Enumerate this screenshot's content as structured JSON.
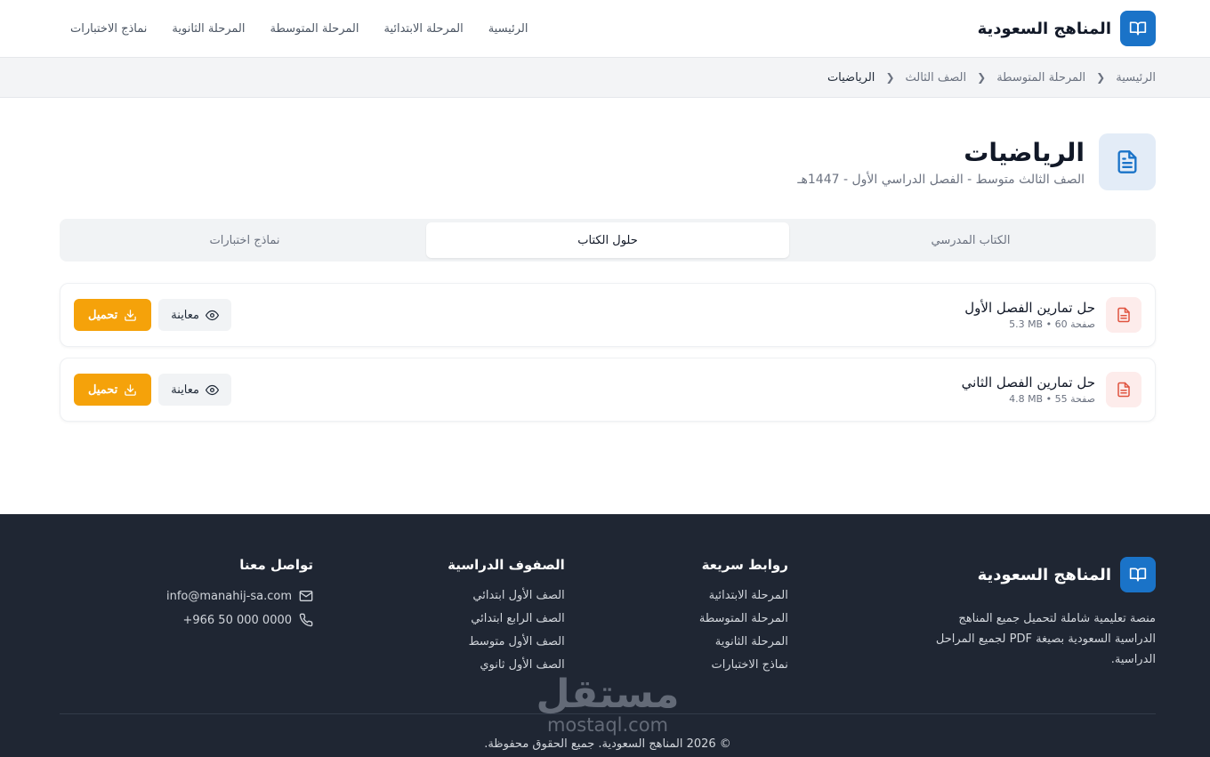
{
  "header": {
    "brand": "المناهج السعودية",
    "nav": [
      "الرئيسية",
      "المرحلة الابتدائية",
      "المرحلة المتوسطة",
      "المرحلة الثانوية",
      "نماذج الاختبارات"
    ]
  },
  "breadcrumb": [
    "الرئيسية",
    "المرحلة المتوسطة",
    "الصف الثالث",
    "الرياضيات"
  ],
  "page": {
    "title": "الرياضيات",
    "subtitle": "الصف الثالث متوسط - الفصل الدراسي الأول - 1447هـ"
  },
  "tabs": [
    {
      "label": "الكتاب المدرسي",
      "active": false
    },
    {
      "label": "حلول الكتاب",
      "active": true
    },
    {
      "label": "نماذج اختبارات",
      "active": false
    }
  ],
  "files": [
    {
      "name": "حل تمارين الفصل الأول",
      "meta": "5.3 MB • 60 صفحة",
      "preview_label": "معاينة",
      "download_label": "تحميل"
    },
    {
      "name": "حل تمارين الفصل الثاني",
      "meta": "4.8 MB • 55 صفحة",
      "preview_label": "معاينة",
      "download_label": "تحميل"
    }
  ],
  "footer": {
    "brand": "المناهج السعودية",
    "description": "منصة تعليمية شاملة لتحميل جميع المناهج الدراسية السعودية بصيغة PDF لجميع المراحل الدراسية.",
    "quick_links": {
      "title": "روابط سريعة",
      "items": [
        "المرحلة الابتدائية",
        "المرحلة المتوسطة",
        "المرحلة الثانوية",
        "نماذج الاختبارات"
      ]
    },
    "grades": {
      "title": "الصفوف الدراسية",
      "items": [
        "الصف الأول ابتدائي",
        "الصف الرابع ابتدائي",
        "الصف الأول متوسط",
        "الصف الأول ثانوي"
      ]
    },
    "contact": {
      "title": "تواصل معنا",
      "email": "info@manahij-sa.com",
      "phone": "+966 50 000 0000"
    },
    "copyright": "© 2026 المناهج السعودية. جميع الحقوق محفوظة."
  },
  "watermark": {
    "arabic": "مستقل",
    "latin": "mostaql.com"
  },
  "colors": {
    "primary": "#1a73c8",
    "accent": "#f5a20a",
    "footer_bg": "#1f2633",
    "pdf_red": "#e0533f"
  }
}
